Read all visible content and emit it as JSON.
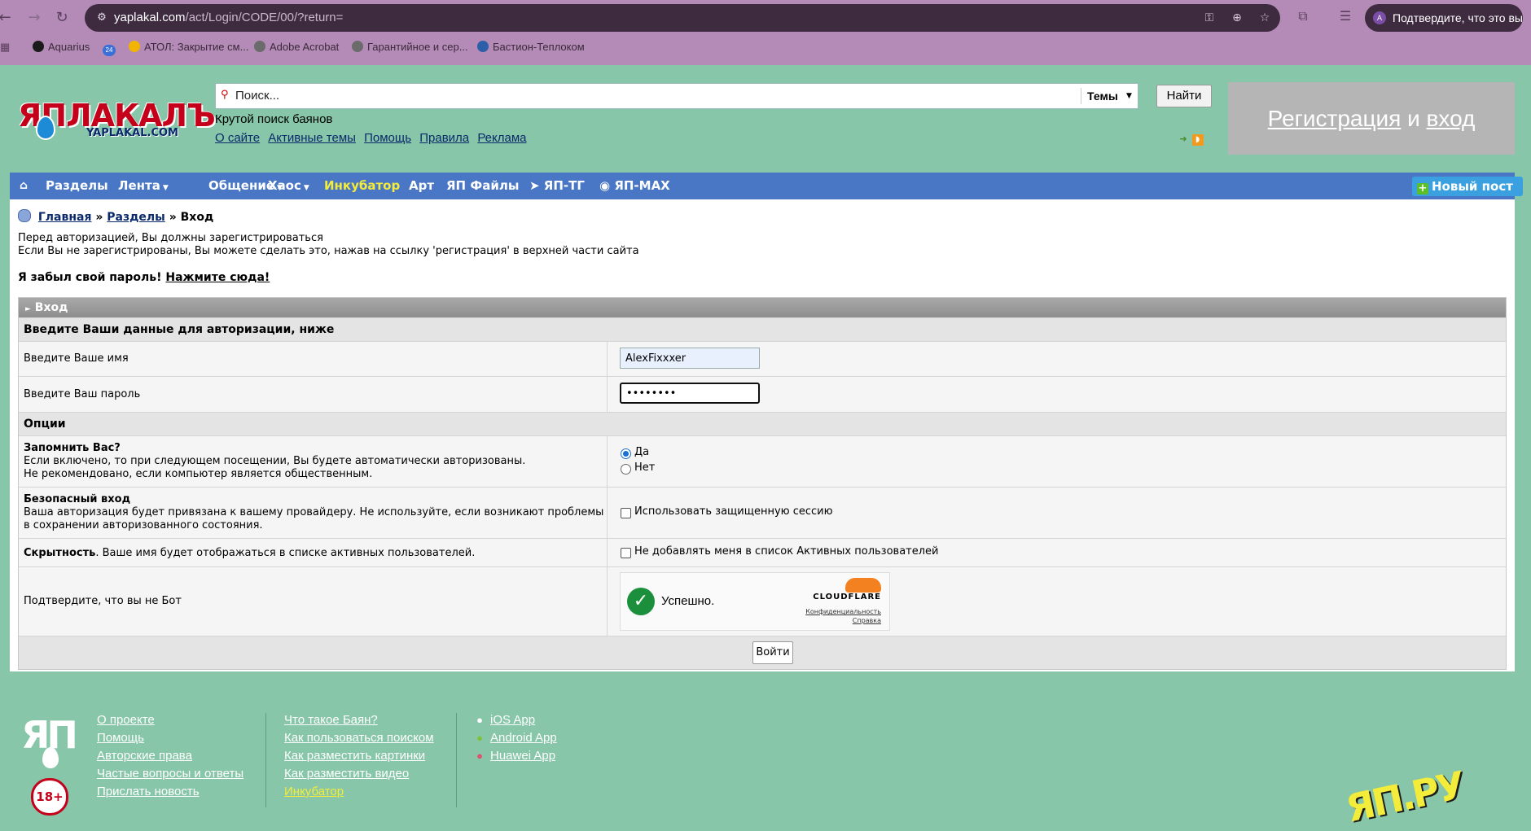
{
  "browser": {
    "url_host": "yaplakal.com",
    "url_path": "/act/Login/CODE/00/?return=",
    "profile_initial": "A",
    "profile_label": "Подтвердите, что это вы",
    "bookmarks": [
      {
        "label": "Aquarius",
        "color": "#1b1b1b"
      },
      {
        "label": "",
        "badge": "24",
        "color": "#3a6fd8"
      },
      {
        "label": "АТОЛ: Закрытие см...",
        "color": "#f2b400"
      },
      {
        "label": "Adobe Acrobat",
        "color": "#6b6b6b"
      },
      {
        "label": "Гарантийное и сер...",
        "color": "#6b6b6b"
      },
      {
        "label": "Бастион-Теплоком",
        "color": "#2b5fa8"
      }
    ]
  },
  "header": {
    "logo_main": "ЯПЛАКАЛЪ",
    "logo_sub": "YAPLAKAL.COM",
    "search_placeholder": "Поиск...",
    "search_scope": "Темы",
    "search_button": "Найти",
    "tagline": "Крутой поиск баянов",
    "links": [
      "О сайте",
      "Активные темы",
      "Помощь",
      "Правила",
      "Реклама"
    ],
    "reg_word": "Регистрация",
    "reg_and": "и",
    "login_word": "вход"
  },
  "menu": {
    "items": [
      {
        "label": "Разделы",
        "caret": false,
        "highlight": false
      },
      {
        "label": "Лента",
        "caret": true,
        "highlight": false
      },
      {
        "label": "Общение",
        "caret": true,
        "highlight": false
      },
      {
        "label": "Хаос",
        "caret": true,
        "highlight": false
      },
      {
        "label": "Инкубатор",
        "caret": false,
        "highlight": true
      },
      {
        "label": "Арт",
        "caret": false,
        "highlight": false
      },
      {
        "label": "ЯП Файлы",
        "caret": false,
        "highlight": false
      },
      {
        "label": "ЯП-ТГ",
        "caret": false,
        "highlight": false
      },
      {
        "label": "ЯП-MAX",
        "caret": false,
        "highlight": false
      }
    ],
    "new_post": "Новый пост"
  },
  "breadcrumb": {
    "home": "Главная",
    "sections": "Разделы",
    "current": "Вход",
    "sep": "»"
  },
  "intro": {
    "line1": "Перед авторизацией, Вы должны зарегистрироваться",
    "line2": "Если Вы не зарегистрированы, Вы можете сделать это, нажав на ссылку 'регистрация' в верхней части сайта",
    "forgot_prefix": "Я забыл свой пароль!",
    "forgot_link": "Нажмите сюда!"
  },
  "form": {
    "title": "Вход",
    "subtitle": "Введите Ваши данные для авторизации, ниже",
    "name_label": "Введите Ваше имя",
    "name_value": "AlexFixxxer",
    "password_label": "Введите Ваш пароль",
    "password_value": "••••••••",
    "options_title": "Опции",
    "remember_title": "Запомнить Вас?",
    "remember_desc1": "Если включено, то при следующем посещении, Вы будете автоматически авторизованы.",
    "remember_desc2": "Не рекомендовано, если компьютер является общественным.",
    "remember_yes": "Да",
    "remember_no": "Нет",
    "remember_selected": "yes",
    "secure_title": "Безопасный вход",
    "secure_desc1": "Ваша авторизация будет привязана к вашему провайдеру. Не используйте, если возникают проблемы",
    "secure_desc2": "в сохранении авторизованного состояния.",
    "secure_checkbox": "Использовать защищенную сессию",
    "secure_checked": false,
    "hidden_title": "Скрытность",
    "hidden_desc": ". Ваше имя будет отображаться в списке активных пользователей.",
    "hidden_checkbox": "Не добавлять меня в список Активных пользователей",
    "hidden_checked": false,
    "bot_label": "Подтвердите, что вы не Бот",
    "captcha_status": "Успешно.",
    "captcha_brand": "CLOUDFLARE",
    "captcha_privacy": "Конфиденциальность",
    "captcha_help": "Справка",
    "submit": "Войти"
  },
  "footer": {
    "logo": "ЯП",
    "age": "18+",
    "col1": [
      "О проекте",
      "Помощь",
      "Авторские права",
      "Частые вопросы и ответы",
      "Прислать новость"
    ],
    "col2": [
      "Что такое Баян?",
      "Как пользоваться поиском",
      "Как разместить картинки",
      "Как разместить видео",
      "Инкубатор"
    ],
    "col3": [
      "iOS App",
      "Android App",
      "Huawei App"
    ],
    "deco": "ЯП.РУ"
  },
  "colors": {
    "page_bg": "#87c6a8",
    "menu_bg": "#4977c6",
    "accent_yellow": "#f4ec3a",
    "logo_red": "#c4001a",
    "chrome_bg": "#b48ab6"
  }
}
